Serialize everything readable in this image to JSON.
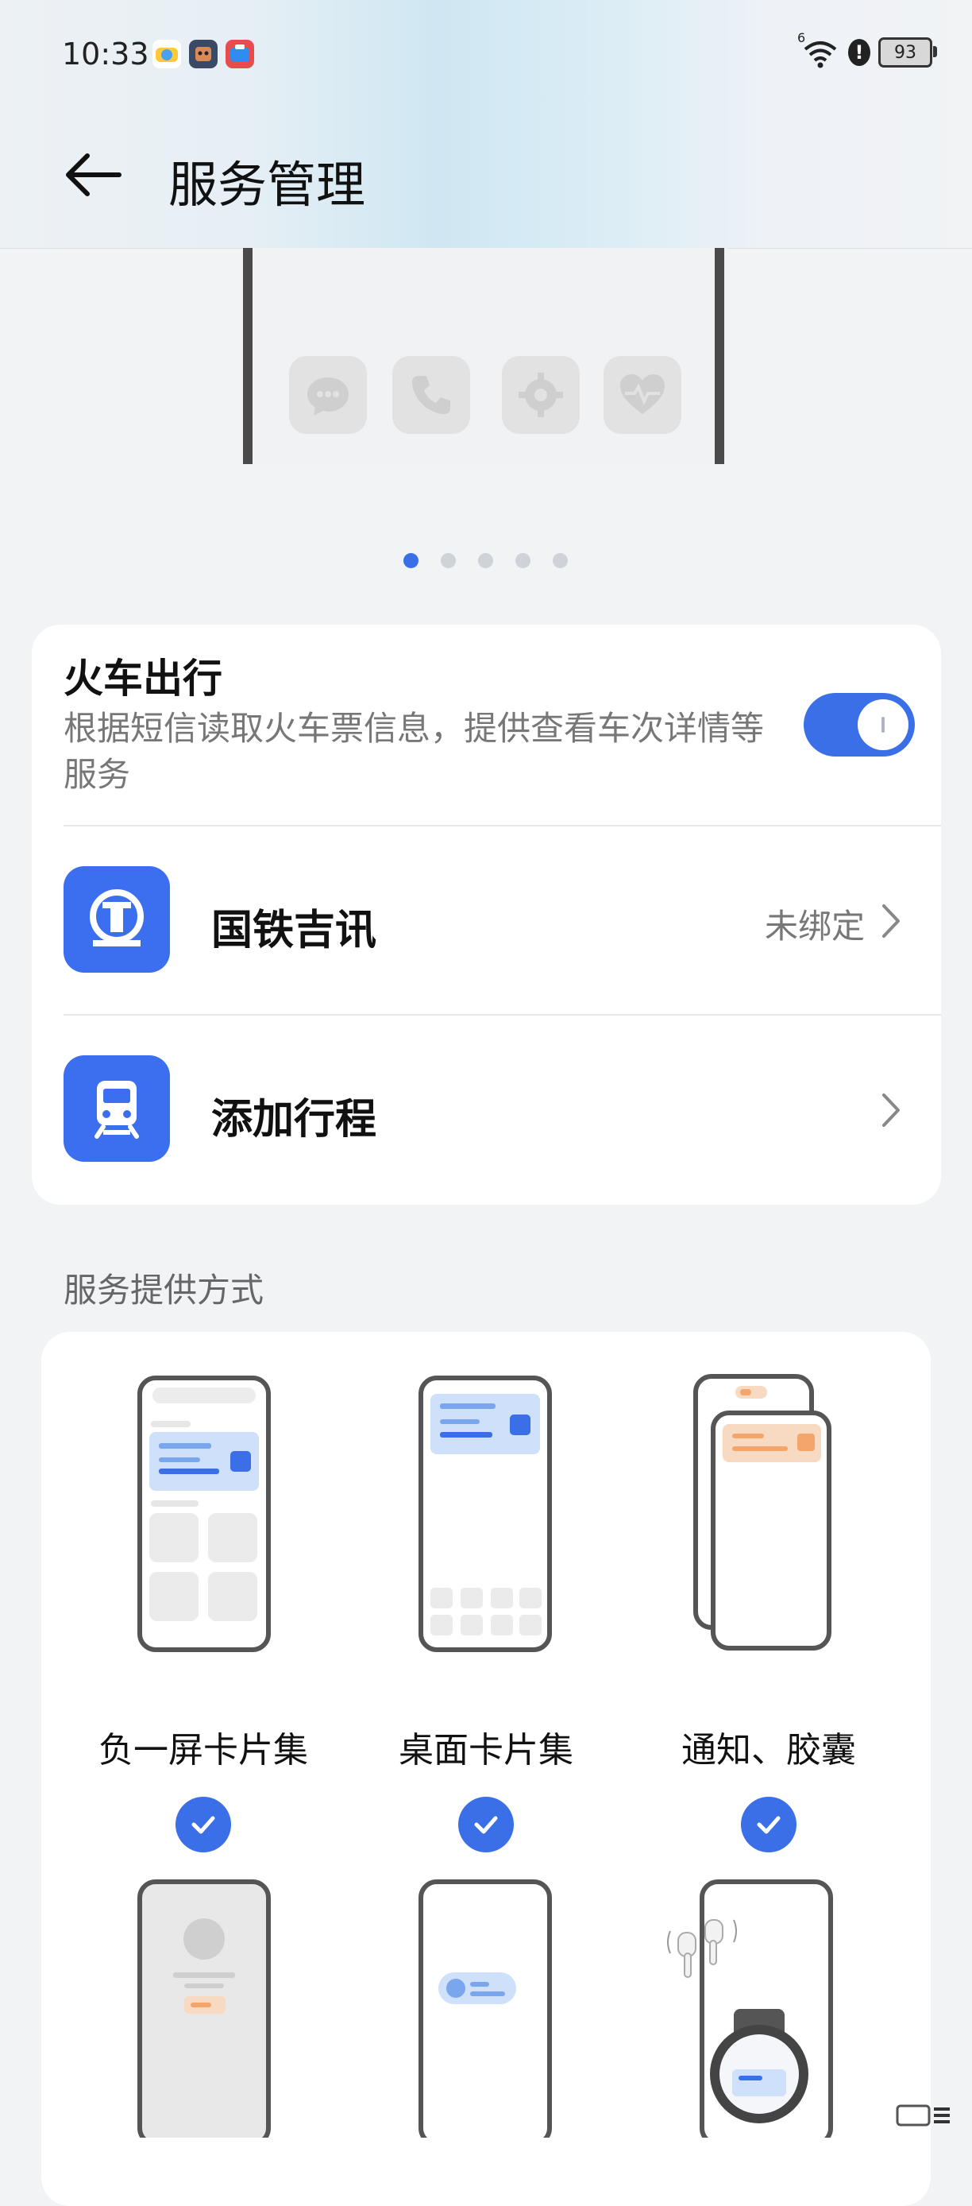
{
  "status_bar": {
    "time": "10:33",
    "battery": "93",
    "signal_label": "6",
    "alert": "!"
  },
  "header": {
    "title": "服务管理"
  },
  "carousel": {
    "page_count": 5,
    "active_index": 0,
    "preview_icons": [
      "message-icon",
      "phone-icon",
      "settings-icon",
      "health-icon"
    ]
  },
  "train_card": {
    "title": "火车出行",
    "description": "根据短信读取火车票信息，提供查看车次详情等服务",
    "toggle_on": true,
    "rows": [
      {
        "label": "国铁吉讯",
        "status": "未绑定",
        "icon": "railway-logo-icon"
      },
      {
        "label": "添加行程",
        "status": "",
        "icon": "train-icon"
      }
    ]
  },
  "service_section": {
    "label": "服务提供方式",
    "options": [
      {
        "label": "负一屏卡片集",
        "checked": true
      },
      {
        "label": "桌面卡片集",
        "checked": true
      },
      {
        "label": "通知、胶囊",
        "checked": true
      }
    ]
  },
  "colors": {
    "accent": "#3b6fe8",
    "app_icon_bg": "#3b6ff0",
    "orange": "#f3a56b"
  }
}
